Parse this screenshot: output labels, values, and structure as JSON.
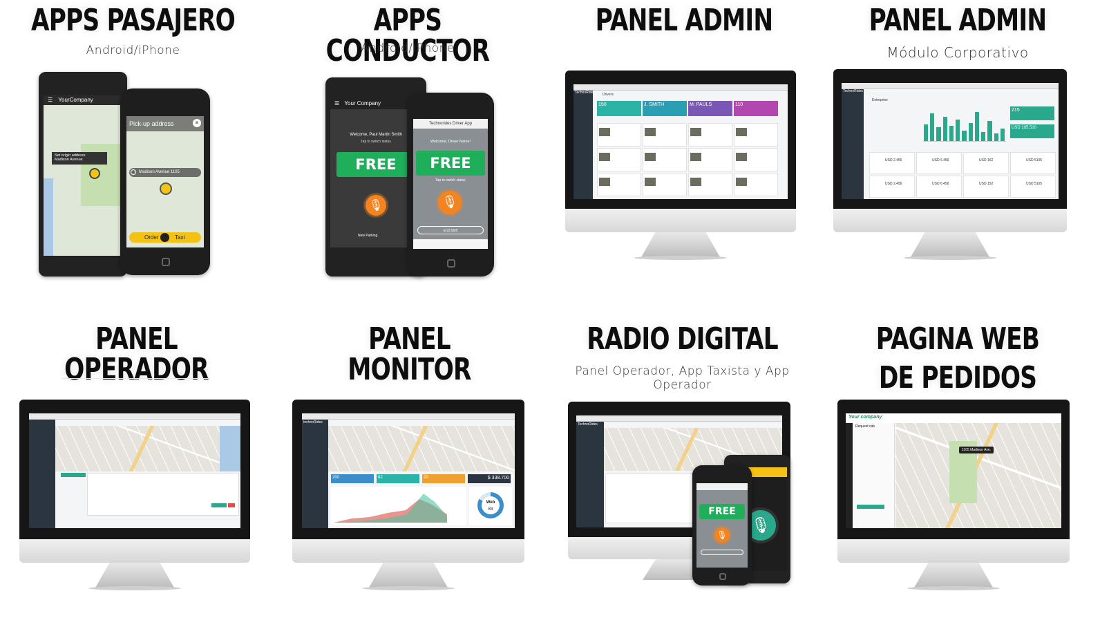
{
  "panels": [
    {
      "title": "APPS PASAJERO",
      "subtitle": "Android/iPhone"
    },
    {
      "title": "APPS CONDUCTOR",
      "subtitle": "Android/iPhone"
    },
    {
      "title": "PANEL ADMIN",
      "subtitle": ""
    },
    {
      "title": "PANEL ADMIN",
      "subtitle": "Módulo Corporativo"
    },
    {
      "title": "PANEL OPERADOR",
      "subtitle": ""
    },
    {
      "title": "PANEL MONITOR",
      "subtitle": ""
    },
    {
      "title": "RADIO DIGITAL",
      "subtitle": "Panel Operador, App Taxista y App Operador"
    },
    {
      "title": "PAGINA WEB",
      "title_line2": "DE PEDIDOS",
      "subtitle": ""
    }
  ],
  "passenger_app": {
    "android_company": "YourCompany",
    "origin_label": "Set origin address",
    "origin_value": "Madison Avenue",
    "pickup_placeholder": "Pick-up address",
    "address_value": "Madison Avenue 1105",
    "order_label": "Order",
    "taxi_label": "Taxi"
  },
  "driver_app": {
    "android_company": "Your Company",
    "welcome": "Welcome, Paul Martin Smith",
    "tap_hint": "Tap to switch status",
    "free_label": "FREE",
    "iphone_header": "Technorides Driver App",
    "iphone_welcome": "Welcome, Driver Name!",
    "end_shift": "End Shift",
    "new_parking": "New Parking"
  },
  "admin_panel": {
    "brand": "TechnoRides",
    "section": "Drivers",
    "kpis": [
      {
        "value": "150",
        "color": "#2ab3a6"
      },
      {
        "value": "J. SMITH",
        "color": "#2a9fb3"
      },
      {
        "value": "M. PAULS",
        "color": "#7b57b5"
      },
      {
        "value": "110",
        "color": "#b347b0"
      }
    ]
  },
  "corporate_panel": {
    "brand": "TechnoRides",
    "section": "Enterprise",
    "kpi_1": "215",
    "kpi_2": "USD 105.510",
    "amounts": [
      "USD 2.456",
      "USD 6.456",
      "USD 152",
      "USD 5105",
      "USD 2.456",
      "USD 6.456",
      "USD 152",
      "USD 5105"
    ],
    "bar_heights": [
      0.55,
      0.9,
      0.45,
      0.8,
      0.5,
      0.7,
      0.35,
      0.6,
      0.95,
      0.3,
      0.65,
      0.25,
      0.4
    ]
  },
  "monitor_panel": {
    "brand": "technoRides",
    "amount": "$ 338.700",
    "donut_label": "Web",
    "donut_value": "83",
    "tile_values": [
      "200",
      "82",
      "20"
    ],
    "tile_colors": [
      "#3b8ec9",
      "#2ab3a6",
      "#f0a030"
    ]
  },
  "radio_panel": {
    "brand": "TechnoRides",
    "free_label": "FREE"
  },
  "web_orders": {
    "brand": "Your company",
    "request": "Request cab",
    "marker": "1105 Madison Ave."
  }
}
